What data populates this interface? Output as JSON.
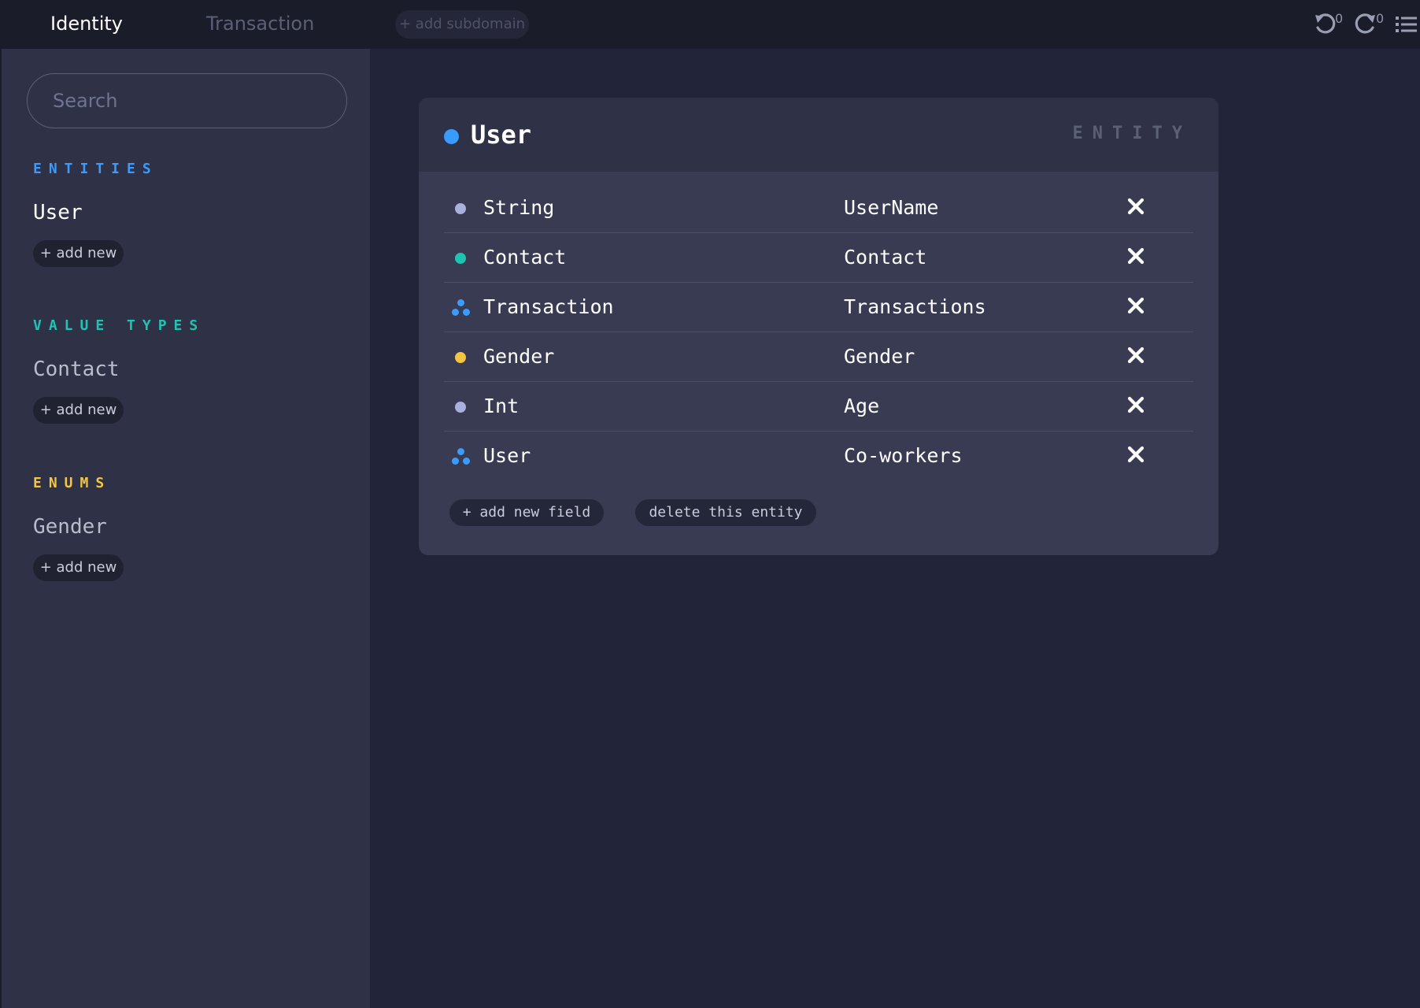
{
  "topbar": {
    "tabs": [
      {
        "label": "Identity",
        "active": true
      },
      {
        "label": "Transaction",
        "active": false
      }
    ],
    "add_subdomain_label": "+ add subdomain",
    "undo_count": "0",
    "redo_count": "0",
    "icons": [
      "undo-icon",
      "redo-icon",
      "list-icon"
    ]
  },
  "sidebar": {
    "search_placeholder": "Search",
    "sections": [
      {
        "heading": "ENTITIES",
        "color": "#3a9bff",
        "items": [
          "User"
        ],
        "add_label": "+ add new"
      },
      {
        "heading": "VALUE TYPES",
        "color": "#1fc4b0",
        "items": [
          "Contact"
        ],
        "add_label": "+ add new"
      },
      {
        "heading": "ENUMS",
        "color": "#f5c542",
        "items": [
          "Gender"
        ],
        "add_label": "+ add new"
      }
    ]
  },
  "card": {
    "title": "User",
    "kind": "ENTITY",
    "dot_color": "#3a9bff",
    "fields": [
      {
        "type": "String",
        "name": "UserName",
        "marker": "dot",
        "color": "#aab0dd"
      },
      {
        "type": "Contact",
        "name": "Contact",
        "marker": "dot",
        "color": "#1fc4b0"
      },
      {
        "type": "Transaction",
        "name": "Transactions",
        "marker": "cluster",
        "color": "#3b9cff"
      },
      {
        "type": "Gender",
        "name": "Gender",
        "marker": "dot",
        "color": "#f5c542"
      },
      {
        "type": "Int",
        "name": "Age",
        "marker": "dot",
        "color": "#aab0dd"
      },
      {
        "type": "User",
        "name": "Co-workers",
        "marker": "cluster",
        "color": "#3b9cff"
      }
    ],
    "add_field_label": "+ add new field",
    "delete_label": "delete this entity"
  }
}
